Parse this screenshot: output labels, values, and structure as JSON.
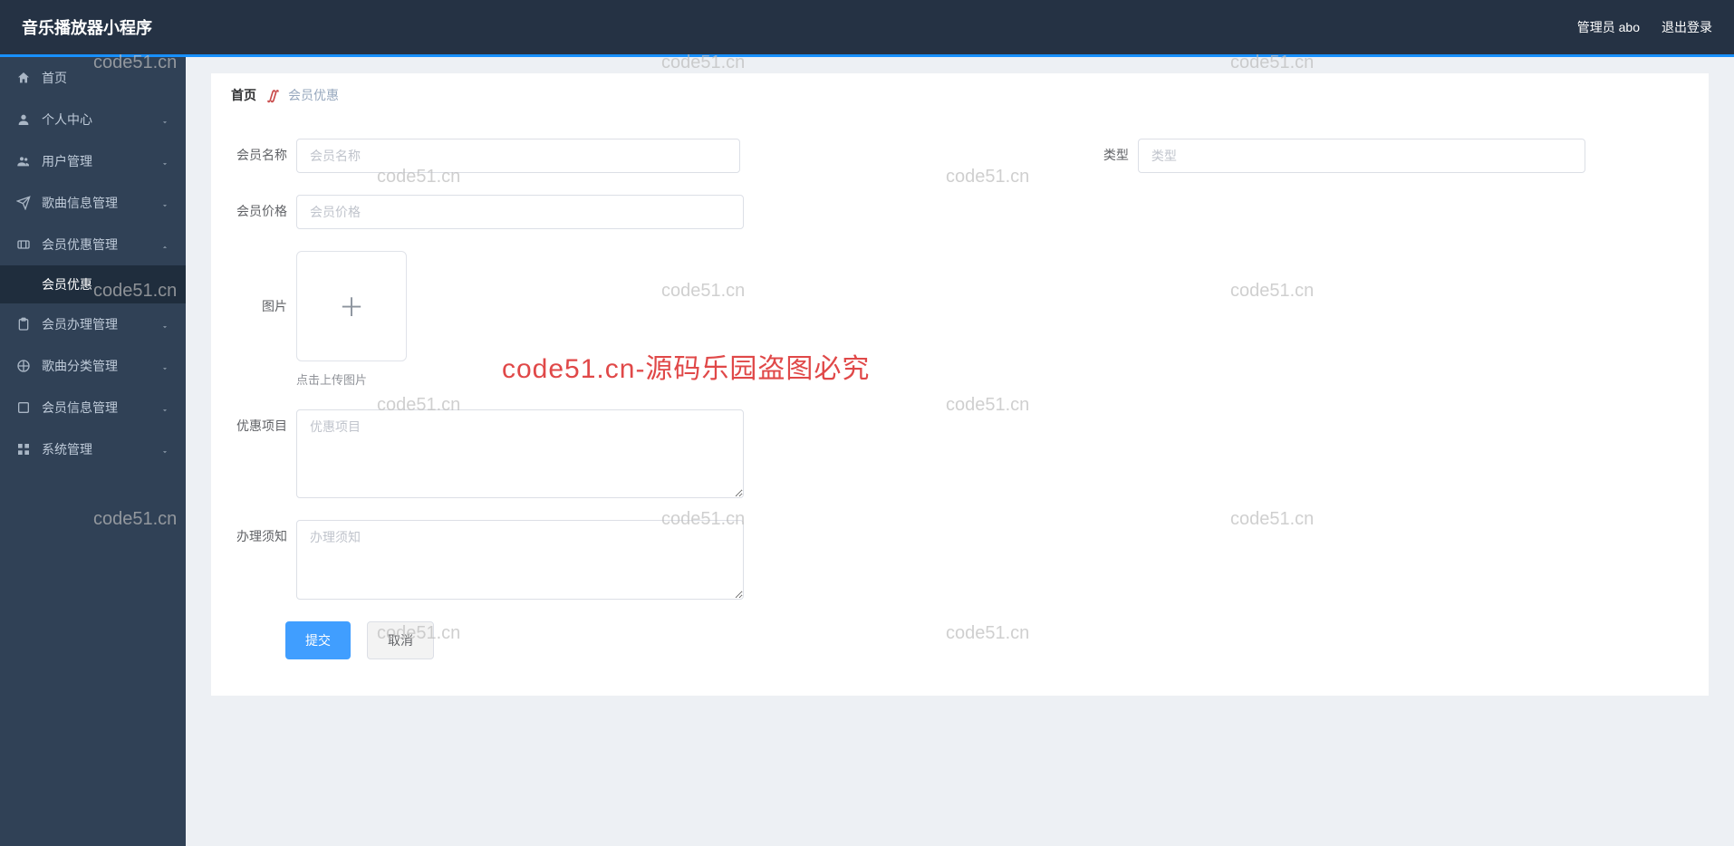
{
  "header": {
    "title": "音乐播放器小程序",
    "admin_label": "管理员 abo",
    "logout": "退出登录"
  },
  "sidebar": {
    "items": [
      {
        "icon": "home",
        "label": "首页",
        "expandable": false
      },
      {
        "icon": "user",
        "label": "个人中心",
        "expandable": true
      },
      {
        "icon": "users",
        "label": "用户管理",
        "expandable": true
      },
      {
        "icon": "music",
        "label": "歌曲信息管理",
        "expandable": true
      },
      {
        "icon": "coupon",
        "label": "会员优惠管理",
        "expandable": true,
        "open": true,
        "children": [
          {
            "label": "会员优惠"
          }
        ]
      },
      {
        "icon": "clip",
        "label": "会员办理管理",
        "expandable": true
      },
      {
        "icon": "category",
        "label": "歌曲分类管理",
        "expandable": true
      },
      {
        "icon": "info",
        "label": "会员信息管理",
        "expandable": true
      },
      {
        "icon": "grid",
        "label": "系统管理",
        "expandable": true
      }
    ]
  },
  "breadcrumb": {
    "home": "首页",
    "current": "会员优惠"
  },
  "form": {
    "name": {
      "label": "会员名称",
      "placeholder": "会员名称"
    },
    "type": {
      "label": "类型",
      "placeholder": "类型"
    },
    "price": {
      "label": "会员价格",
      "placeholder": "会员价格"
    },
    "image": {
      "label": "图片",
      "hint": "点击上传图片"
    },
    "benefit": {
      "label": "优惠项目",
      "placeholder": "优惠项目"
    },
    "notice": {
      "label": "办理须知",
      "placeholder": "办理须知"
    },
    "submit": "提交",
    "cancel": "取消"
  },
  "watermark": {
    "text": "code51.cn",
    "big": "code51.cn-源码乐园盗图必究"
  }
}
